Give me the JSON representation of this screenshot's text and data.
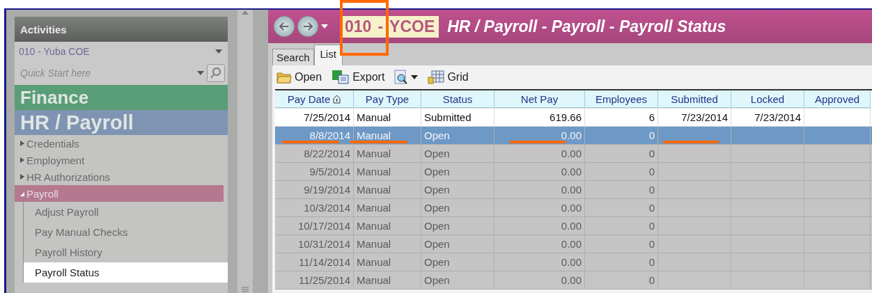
{
  "sidebar": {
    "header": "Activities",
    "district": "010 - Yuba COE",
    "quick_start": {
      "placeholder": "Quick Start here"
    },
    "modules": [
      {
        "label": "Finance",
        "color": "#5a9e78"
      },
      {
        "label": "HR / Payroll",
        "color": "#7f93b3"
      }
    ],
    "tree": [
      {
        "label": "Credentials",
        "expanded": false
      },
      {
        "label": "Employment",
        "expanded": false
      },
      {
        "label": "HR Authorizations",
        "expanded": false
      },
      {
        "label": "Payroll",
        "expanded": true,
        "children": [
          {
            "label": "Adjust Payroll",
            "selected": false
          },
          {
            "label": "Pay Manual Checks",
            "selected": false
          },
          {
            "label": "Payroll History",
            "selected": false
          },
          {
            "label": "Payroll Status",
            "selected": true
          }
        ]
      }
    ]
  },
  "header": {
    "district_code": "010",
    "separator": "-",
    "district_name": "YCOE",
    "title": "HR / Payroll - Payroll - Payroll Status"
  },
  "tabs": [
    {
      "label": "Search",
      "selected": false
    },
    {
      "label": "List",
      "selected": true
    }
  ],
  "toolbar": [
    {
      "label": "Open",
      "kind": "open"
    },
    {
      "label": "Export",
      "kind": "export"
    },
    {
      "kind": "preview"
    },
    {
      "label": "Grid",
      "kind": "grid"
    }
  ],
  "table": {
    "columns": [
      {
        "label": "Pay Date",
        "sorted": true
      },
      {
        "label": "Pay Type",
        "sorted": false
      },
      {
        "label": "Status",
        "sorted": false
      },
      {
        "label": "Net Pay",
        "sorted": false
      },
      {
        "label": "Employees",
        "sorted": false
      },
      {
        "label": "Submitted",
        "sorted": false
      },
      {
        "label": "Locked",
        "sorted": false
      },
      {
        "label": "Approved",
        "sorted": false
      }
    ],
    "rows": [
      {
        "cells": [
          "7/25/2014",
          "Manual",
          "Submitted",
          "619.66",
          "6",
          "7/23/2014",
          "7/23/2014",
          ""
        ],
        "selected": false,
        "dimmed": false
      },
      {
        "cells": [
          "8/8/2014",
          "Manual",
          "Open",
          "0.00",
          "0",
          "",
          "",
          ""
        ],
        "selected": true,
        "dimmed": true
      },
      {
        "cells": [
          "8/22/2014",
          "Manual",
          "Open",
          "0.00",
          "0",
          "",
          "",
          ""
        ],
        "selected": false,
        "dimmed": true
      },
      {
        "cells": [
          "9/5/2014",
          "Manual",
          "Open",
          "0.00",
          "0",
          "",
          "",
          ""
        ],
        "selected": false,
        "dimmed": true
      },
      {
        "cells": [
          "9/19/2014",
          "Manual",
          "Open",
          "0.00",
          "0",
          "",
          "",
          ""
        ],
        "selected": false,
        "dimmed": true
      },
      {
        "cells": [
          "10/3/2014",
          "Manual",
          "Open",
          "0.00",
          "0",
          "",
          "",
          ""
        ],
        "selected": false,
        "dimmed": true
      },
      {
        "cells": [
          "10/17/2014",
          "Manual",
          "Open",
          "0.00",
          "0",
          "",
          "",
          ""
        ],
        "selected": false,
        "dimmed": true
      },
      {
        "cells": [
          "10/31/2014",
          "Manual",
          "Open",
          "0.00",
          "0",
          "",
          "",
          ""
        ],
        "selected": false,
        "dimmed": true
      },
      {
        "cells": [
          "11/14/2014",
          "Manual",
          "Open",
          "0.00",
          "0",
          "",
          "",
          ""
        ],
        "selected": false,
        "dimmed": true
      },
      {
        "cells": [
          "11/25/2014",
          "Manual",
          "Open",
          "0.00",
          "0",
          "",
          "",
          ""
        ],
        "selected": false,
        "dimmed": true
      }
    ]
  }
}
